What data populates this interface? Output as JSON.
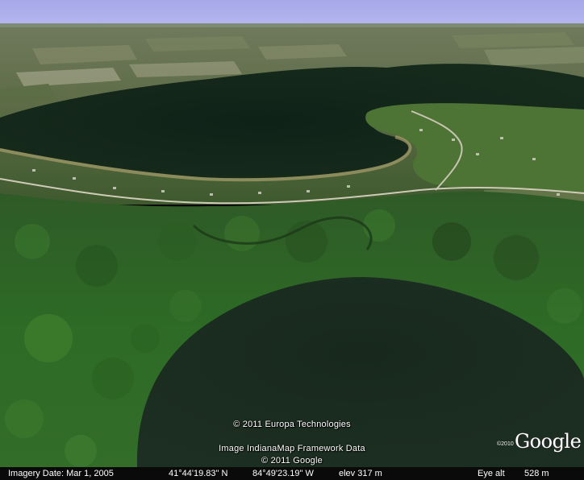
{
  "viewer": {
    "credits": {
      "line1": "© 2011 Europa Technologies",
      "line2": "Image IndianaMap Framework Data",
      "line3": "© 2011 Google"
    },
    "logo": {
      "year": "©2010",
      "word": "Google"
    }
  },
  "status": {
    "imagery_date": "Imagery Date: Mar  1, 2005",
    "latitude": "41°44'19.83\" N",
    "longitude": "84°49'23.19\" W",
    "elevation": "elev  317 m",
    "eye_alt_label": "Eye alt",
    "eye_alt_value": "528 m"
  }
}
